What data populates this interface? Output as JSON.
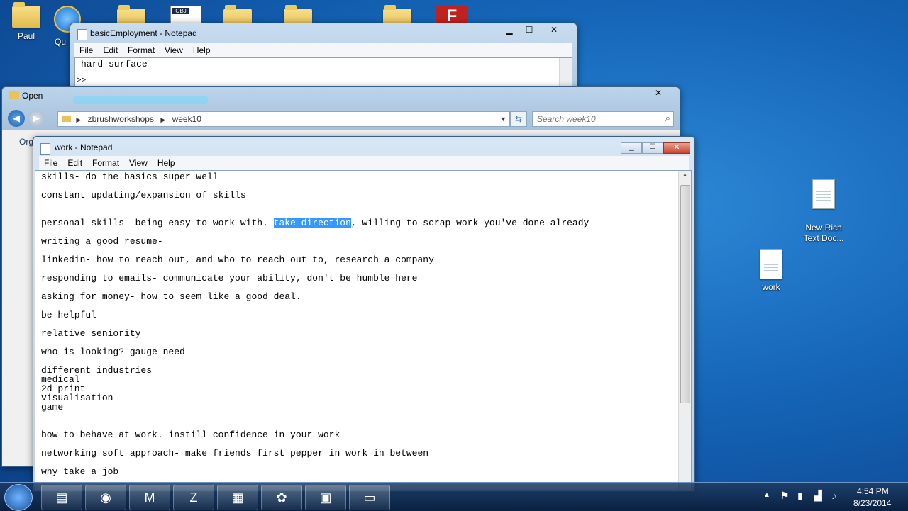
{
  "desktop": {
    "icons": {
      "paul": "Paul",
      "qu": "Qu",
      "new_rich": "New Rich\nText Doc...",
      "work": "work"
    },
    "obj_badge": "OBJ"
  },
  "basic_window": {
    "title": "basicEmployment - Notepad",
    "menu": [
      "File",
      "Edit",
      "Format",
      "View",
      "Help"
    ],
    "text_line1": "hard surface",
    "text_line2": ">>"
  },
  "open_dialog": {
    "title": "Open",
    "breadcrumb": [
      "zbrushworkshops",
      "week10"
    ],
    "search_placeholder": "Search week10",
    "org_label": "Org"
  },
  "work_window": {
    "title": "work - Notepad",
    "menu": [
      "File",
      "Edit",
      "Format",
      "View",
      "Help"
    ],
    "lines": {
      "l1": "skills- do the basics super well",
      "l2": "constant updating/expansion of skills",
      "l3a": "personal skills- being easy to work with. ",
      "l3sel": "take direction",
      "l3b": ", willing to scrap work you've done already",
      "l4": "writing a good resume-",
      "l5": "linkedin- how to reach out, and who to reach out to, research a company",
      "l6": "responding to emails- communicate your ability, don't be humble here",
      "l7": "asking for money- how to seem like a good deal.",
      "l8": "be helpful",
      "l9": "relative seniority",
      "l10": "who is looking? gauge need",
      "l11": "different industries",
      "l12": "medical",
      "l13": "2d print",
      "l14": "visualisation",
      "l15": "game",
      "l16": "how to behave at work. instill confidence in your work",
      "l17": "networking soft approach- make friends first pepper in work in between",
      "l18": "why take a job"
    }
  },
  "taskbar": {
    "time": "4:54 PM",
    "date": "8/23/2014"
  },
  "colors": {
    "selection": "#3399ff",
    "close_red": "#c9442f"
  }
}
